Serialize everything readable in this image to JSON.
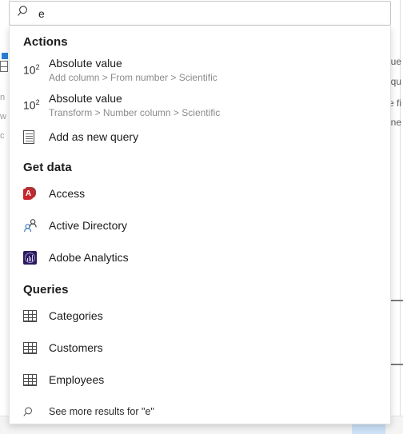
{
  "search": {
    "value": "e",
    "placeholder": "Search",
    "icon": "search-icon"
  },
  "groups": [
    {
      "id": "actions",
      "header": "Actions",
      "items": [
        {
          "title": "Absolute value",
          "subtitle": "Add column > From number > Scientific",
          "icon": "ten-squared-icon",
          "icon_text": "10",
          "icon_sup": "2"
        },
        {
          "title": "Absolute value",
          "subtitle": "Transform > Number column > Scientific",
          "icon": "ten-squared-icon",
          "icon_text": "10",
          "icon_sup": "2"
        },
        {
          "title": "Add as new query",
          "subtitle": "",
          "icon": "document-icon"
        }
      ]
    },
    {
      "id": "get-data",
      "header": "Get data",
      "items": [
        {
          "title": "Access",
          "subtitle": "",
          "icon": "access-icon"
        },
        {
          "title": "Active Directory",
          "subtitle": "",
          "icon": "active-directory-icon"
        },
        {
          "title": "Adobe Analytics",
          "subtitle": "",
          "icon": "adobe-analytics-icon"
        }
      ]
    },
    {
      "id": "queries",
      "header": "Queries",
      "items": [
        {
          "title": "Categories",
          "subtitle": "",
          "icon": "table-icon"
        },
        {
          "title": "Customers",
          "subtitle": "",
          "icon": "table-icon"
        },
        {
          "title": "Employees",
          "subtitle": "",
          "icon": "table-icon"
        }
      ]
    }
  ],
  "footer": {
    "see_more_label": "See more results for \"e\"",
    "icon": "search-icon"
  },
  "background": {
    "right_fragments": [
      "ue",
      "qu",
      "e fi",
      "ne"
    ],
    "left_fragments": [
      "n",
      "w",
      "c"
    ]
  },
  "colors": {
    "panel_bg": "#ffffff",
    "panel_border": "#e1e1e1",
    "text_primary": "#1b1b1b",
    "text_secondary": "#8a8a8a",
    "access_red": "#c5272d",
    "adobe_purple": "#2b1a5c",
    "ad_blue": "#3b7fc4",
    "selection_blue": "#cde2f7"
  }
}
